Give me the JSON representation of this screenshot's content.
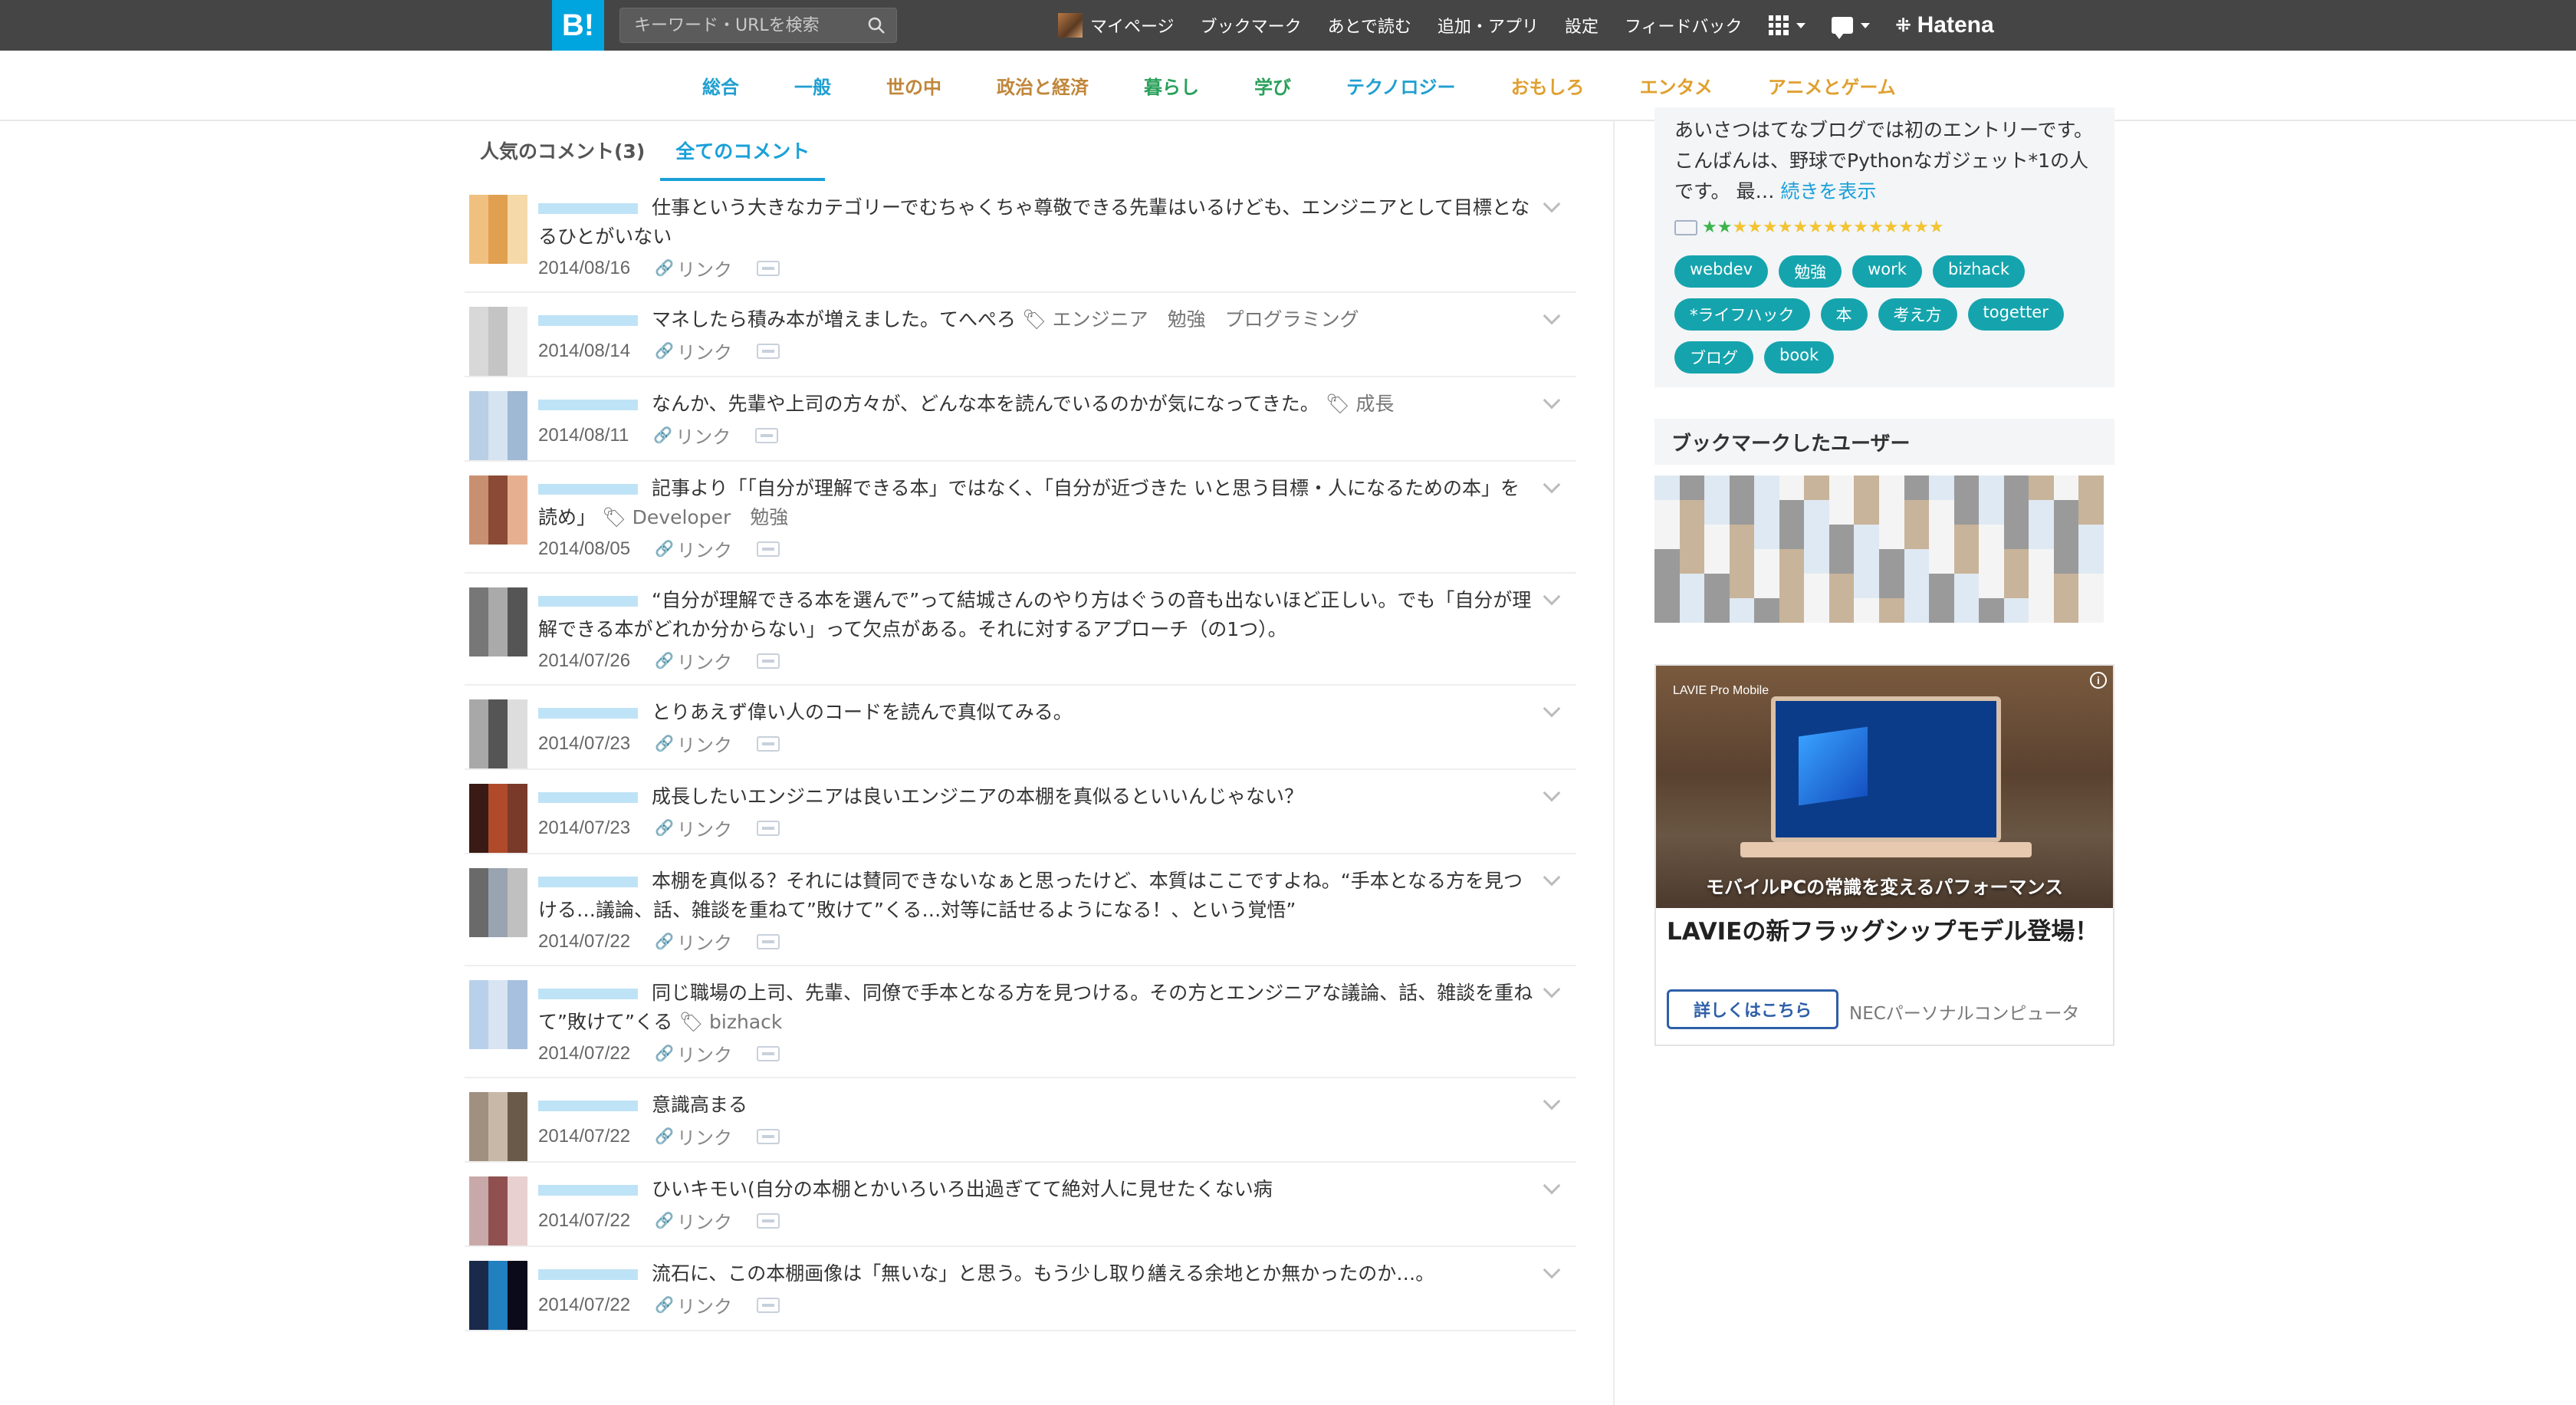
{
  "header": {
    "logo": "B!",
    "search_placeholder": "キーワード・URLを検索",
    "nav": {
      "mypage": "マイページ",
      "bookmark": "ブックマーク",
      "later": "あとで読む",
      "add_app": "追加・アプリ",
      "settings": "設定",
      "feedback": "フィードバック"
    },
    "brand": "Hatena"
  },
  "categories": [
    {
      "label": "総合",
      "color": "#1f9fd0"
    },
    {
      "label": "一般",
      "color": "#1f9fd0"
    },
    {
      "label": "世の中",
      "color": "#c0863a"
    },
    {
      "label": "政治と経済",
      "color": "#c0863a"
    },
    {
      "label": "暮らし",
      "color": "#2aa05a"
    },
    {
      "label": "学び",
      "color": "#2aa05a"
    },
    {
      "label": "テクノロジー",
      "color": "#1f9fd0"
    },
    {
      "label": "おもしろ",
      "color": "#e0a030"
    },
    {
      "label": "エンタメ",
      "color": "#e0a030"
    },
    {
      "label": "アニメとゲーム",
      "color": "#e0a030"
    }
  ],
  "tabs": {
    "popular": "人気のコメント(3)",
    "all": "全てのコメント"
  },
  "link_label": "リンク",
  "comments": [
    {
      "text": "仕事という大きなカテゴリーでむちゃくちゃ尊敬できる先輩はいるけども、エンジニアとして目標となるひとがいない",
      "tags": "",
      "date": "2014/08/16"
    },
    {
      "text": "マネしたら積み本が増えました。てへぺろ",
      "tags": "エンジニア　勉強　プログラミング",
      "date": "2014/08/14"
    },
    {
      "text": "なんか、先輩や上司の方々が、どんな本を読んでいるのかが気になってきた。",
      "tags": "成長",
      "date": "2014/08/11"
    },
    {
      "text": "記事より「「自分が理解できる本」ではなく、「自分が近づきた いと思う目標・人になるための本」を読め」",
      "tags": "Developer　勉強",
      "date": "2014/08/05"
    },
    {
      "text": "“自分が理解できる本を選んで”って結城さんのやり方はぐうの音も出ないほど正しい。でも「自分が理解できる本がどれか分からない」って欠点がある。それに対するアプローチ（の1つ）。",
      "tags": "",
      "date": "2014/07/26"
    },
    {
      "text": "とりあえず偉い人のコードを読んで真似てみる。",
      "tags": "",
      "date": "2014/07/23"
    },
    {
      "text": "成長したいエンジニアは良いエンジニアの本棚を真似るといいんじゃない？",
      "tags": "",
      "date": "2014/07/23"
    },
    {
      "text": "本棚を真似る？それには賛同できないなぁと思ったけど、本質はここですよね。“手本となる方を見つける…議論、話、雑談を重ねて”敗けて”くる…対等に話せるようになる！、という覚悟”",
      "tags": "",
      "date": "2014/07/22"
    },
    {
      "text": "同じ職場の上司、先輩、同僚で手本となる方を見つける。その方とエンジニアな議論、話、雑談を重ねて”敗けて”くる",
      "tags": "bizhack",
      "date": "2014/07/22"
    },
    {
      "text": "意識高まる",
      "tags": "",
      "date": "2014/07/22"
    },
    {
      "text": "ひいキモい(自分の本棚とかいろいろ出過ぎてて絶対人に見せたくない病",
      "tags": "",
      "date": "2014/07/22"
    },
    {
      "text": "流石に、この本棚画像は「無いな」と思う。もう少し取り繕える余地とか無かったのか…。",
      "tags": "",
      "date": "2014/07/22"
    }
  ],
  "sidebar": {
    "bio_text": "あいさつはてなブログでは初のエントリーです。こんばんは、野球でPythonなガジェット*1の人です。 最…",
    "bio_more": "続きを表示",
    "tags": [
      "webdev",
      "勉強",
      "work",
      "bizhack",
      "*ライフハック",
      "本",
      "考え方",
      "togetter",
      "ブログ",
      "book"
    ],
    "users_title": "ブックマークしたユーザー"
  },
  "ad": {
    "brand": "LAVIE Pro Mobile",
    "caption": "モバイルPCの常識を変えるパフォーマンス",
    "title": "LAVIEの新フラッグシップモデル登場！",
    "button": "詳しくはこちら",
    "advertiser": "NECパーソナルコンピュータ"
  },
  "colors": {
    "topbar": "#454545",
    "logo_bg": "#00a4de",
    "accent": "#1aa0d8",
    "tag_bg": "#15a4ad"
  }
}
